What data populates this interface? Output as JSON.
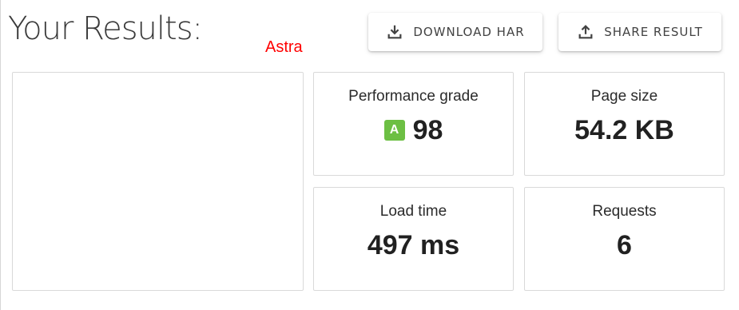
{
  "header": {
    "title": "Your Results:",
    "site_label": "Astra"
  },
  "actions": {
    "download_label": "DOWNLOAD HAR",
    "download_icon": "download-icon",
    "share_label": "SHARE RESULT",
    "share_icon": "upload-share-icon"
  },
  "metrics": {
    "performance": {
      "label": "Performance grade",
      "grade": "A",
      "value": "98",
      "grade_color": "#6cbf43"
    },
    "page_size": {
      "label": "Page size",
      "value": "54.2 KB"
    },
    "load_time": {
      "label": "Load time",
      "value": "497 ms"
    },
    "requests": {
      "label": "Requests",
      "value": "6"
    }
  },
  "colors": {
    "site_label": "#ff0000",
    "text": "#212121",
    "border": "#d9d9d9"
  }
}
